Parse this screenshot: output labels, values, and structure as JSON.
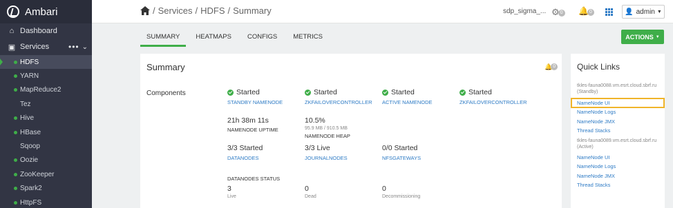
{
  "app": {
    "name": "Ambari"
  },
  "sidebar": {
    "dashboard": "Dashboard",
    "services": "Services",
    "items": [
      {
        "label": "HDFS",
        "dot": true,
        "active": true
      },
      {
        "label": "YARN",
        "dot": true
      },
      {
        "label": "MapReduce2",
        "dot": true
      },
      {
        "label": "Tez",
        "dot": false
      },
      {
        "label": "Hive",
        "dot": true
      },
      {
        "label": "HBase",
        "dot": true
      },
      {
        "label": "Sqoop",
        "dot": false
      },
      {
        "label": "Oozie",
        "dot": true
      },
      {
        "label": "ZooKeeper",
        "dot": true
      },
      {
        "label": "Spark2",
        "dot": true
      },
      {
        "label": "HttpFS",
        "dot": true
      }
    ]
  },
  "header": {
    "breadcrumb": [
      "Services",
      "HDFS",
      "Summary"
    ],
    "cluster": "sdp_sigma_...",
    "ops_count": "0",
    "alerts_count": "0",
    "user": "admin"
  },
  "tabs": [
    "SUMMARY",
    "HEATMAPS",
    "CONFIGS",
    "METRICS"
  ],
  "actions_label": "ACTIONS",
  "summary": {
    "title": "Summary",
    "alerts": "0",
    "components_label": "Components",
    "status": [
      {
        "state": "Started",
        "name": "STANDBY NAMENODE"
      },
      {
        "state": "Started",
        "name": "ZKFAILOVERCONTROLLER"
      },
      {
        "state": "Started",
        "name": "ACTIVE NAMENODE"
      },
      {
        "state": "Started",
        "name": "ZKFAILOVERCONTROLLER"
      }
    ],
    "uptime": {
      "value": "21h 38m 11s",
      "label": "NAMENODE UPTIME"
    },
    "heap": {
      "value": "10.5%",
      "detail": "95.9 MB / 910.5 MB",
      "label": "NAMENODE HEAP"
    },
    "datanodes": {
      "value": "3/3 Started",
      "label": "DATANODES"
    },
    "journalnodes": {
      "value": "3/3 Live",
      "label": "JOURNALNODES"
    },
    "nfsgateways": {
      "value": "0/0 Started",
      "label": "NFSGATEWAYS"
    },
    "dn_status": {
      "label": "DATANODES STATUS",
      "live": {
        "value": "3",
        "label": "Live"
      },
      "dead": {
        "value": "0",
        "label": "Dead"
      },
      "decom": {
        "value": "0",
        "label": "Decommissioning"
      }
    }
  },
  "quick_links": {
    "title": "Quick Links",
    "groups": [
      {
        "host": "tkles-fauna0088.vm.esrt.cloud.sbrf.ru",
        "role": "(Standby)",
        "links": [
          "NameNode UI",
          "NameNode Logs",
          "NameNode JMX",
          "Thread Stacks"
        ]
      },
      {
        "host": "tkles-fauna0089.vm.esrt.cloud.sbrf.ru",
        "role": "(Active)",
        "links": [
          "NameNode UI",
          "NameNode Logs",
          "NameNode JMX",
          "Thread Stacks"
        ]
      }
    ],
    "highlight_color": "#f0b429"
  },
  "colors": {
    "accent": "#3fae49",
    "link": "#2e7bc5",
    "sidebar": "#323544"
  }
}
